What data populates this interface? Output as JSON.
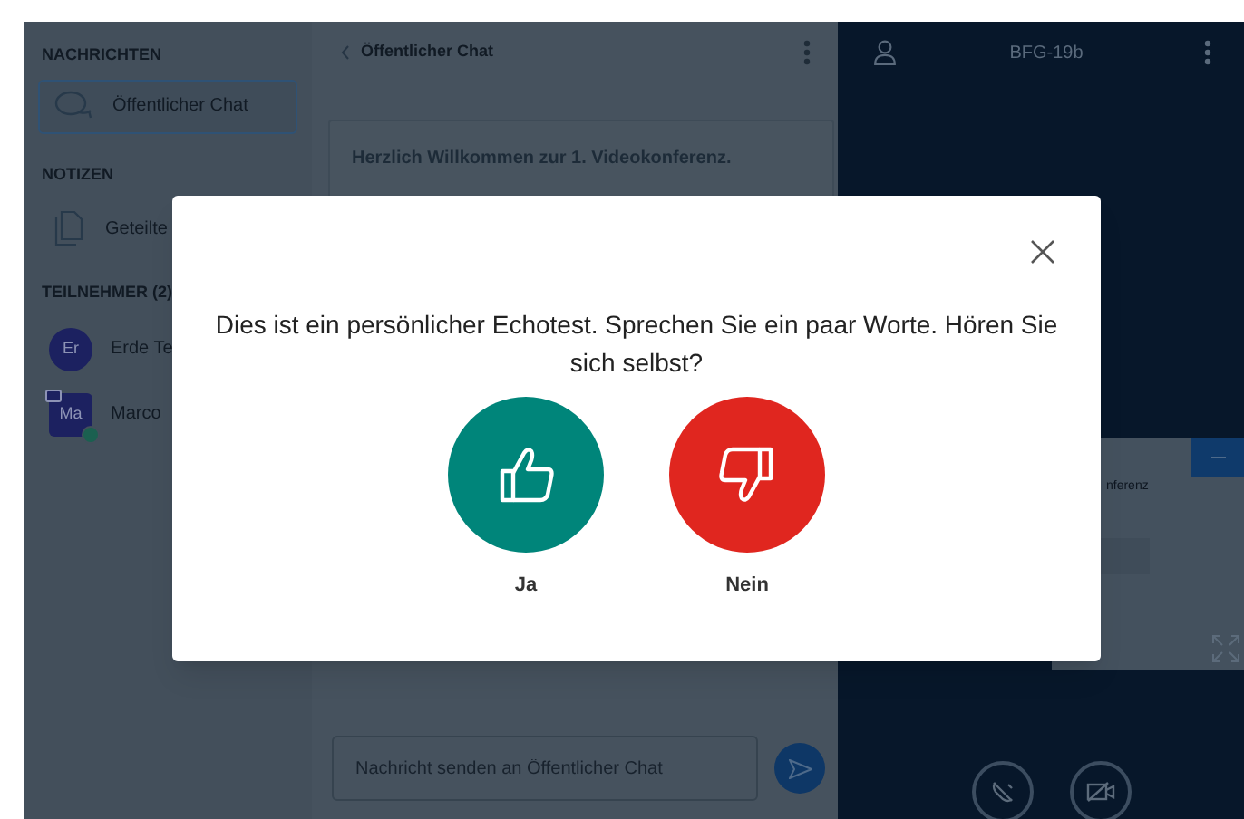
{
  "sidebar": {
    "messages": {
      "heading": "NACHRICHTEN",
      "items": [
        {
          "label": "Öffentlicher Chat",
          "selected": true
        }
      ]
    },
    "notes": {
      "heading": "NOTIZEN",
      "items": [
        {
          "label": "Geteilte",
          "selected": false
        }
      ]
    },
    "participants": {
      "heading": "TEILNEHMER (2)",
      "users": [
        {
          "initials": "Er",
          "name": "Erde Te",
          "kind": "viewer",
          "presenter": false,
          "voice": false
        },
        {
          "initials": "Ma",
          "name": "Marco",
          "kind": "moderator",
          "presenter": true,
          "voice": true
        }
      ]
    }
  },
  "chat": {
    "title": "Öffentlicher Chat",
    "messages": [
      {
        "text": "Herzlich Willkommen zur 1. Videokonferenz."
      }
    ],
    "input": {
      "placeholder": "Nachricht senden an Öffentlicher Chat"
    }
  },
  "meeting": {
    "title": "BFG-19b",
    "slide_text": "nferenz"
  },
  "dialog": {
    "message": "Dies ist ein persönlicher Echotest. Sprechen Sie ein paar Worte. Hören Sie sich selbst?",
    "options": [
      {
        "kind": "yes",
        "label": "Ja"
      },
      {
        "kind": "no",
        "label": "Nein"
      }
    ]
  }
}
